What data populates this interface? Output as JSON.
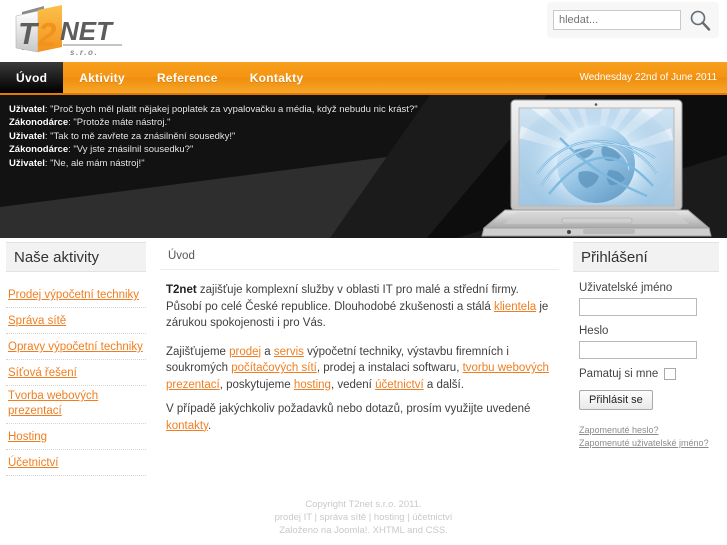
{
  "site": {
    "logo_main": "NET",
    "logo_t": "T",
    "logo_2": "2",
    "logo_sub": "s . r . o ."
  },
  "search": {
    "placeholder": "hledat...",
    "value": "",
    "icon": "search-icon"
  },
  "nav": {
    "items": [
      {
        "label": "Úvod",
        "active": true
      },
      {
        "label": "Aktivity",
        "active": false
      },
      {
        "label": "Reference",
        "active": false
      },
      {
        "label": "Kontakty",
        "active": false
      }
    ],
    "date": "Wednesday 22nd of June 2011"
  },
  "banner": {
    "lines": [
      {
        "speaker": "Uživatel",
        "text": ": \"Proč bych měl platit nějakej poplatek za vypalovačku a média, když nebudu nic krást?\""
      },
      {
        "speaker": "Zákonodárce",
        "text": ": \"Protože máte nástroj.\""
      },
      {
        "speaker": "Uživatel",
        "text": ": \"Tak to mě zavřete za znásilnění sousedky!\""
      },
      {
        "speaker": "Zákonodárce",
        "text": ": \"Vy jste znásilnil sousedku?\""
      },
      {
        "speaker": "Uživatel",
        "text": ": \"Ne, ale mám nástroj!\""
      }
    ],
    "image_name": "laptop-globe-network-graphic"
  },
  "sidebar": {
    "title": "Naše aktivity",
    "items": [
      {
        "label": "Prodej výpočetní techniky"
      },
      {
        "label": "Správa sítě"
      },
      {
        "label": "Opravy výpočetní techniky"
      },
      {
        "label": "Síťová řešení"
      },
      {
        "label": "Tvorba webových prezentací"
      },
      {
        "label": "Hosting"
      },
      {
        "label": "Účetnictví"
      }
    ]
  },
  "content": {
    "title": "Úvod",
    "p1": {
      "brand": "T2net",
      "t1": " zajišťuje komplexní služby v oblasti IT pro malé a střední firmy. Působí po celé České republice. Dlouhodobé zkušenosti a stálá ",
      "link1": "klientela",
      "t2": " je zárukou spokojenosti i pro Vás."
    },
    "p2": {
      "t1": "Zajišťujeme ",
      "link1": "prodej",
      "t2": " a ",
      "link2": "servis",
      "t3": " výpočetní techniky, výstavbu firemních i soukromých ",
      "link3": "počítačových sítí",
      "t4": ", prodej a instalaci softwaru, ",
      "link4": "tvorbu webových prezentací",
      "t5": ", poskytujeme ",
      "link5": "hosting",
      "t6": ", vedení ",
      "link6": "účetnictví",
      "t7": " a další."
    },
    "p3": {
      "t1": "V případě jakýchkoliv požadavků nebo dotazů, prosím využijte uvedené ",
      "link1": "kontakty",
      "t2": "."
    }
  },
  "login": {
    "title": "Přihlášení",
    "username_label": "Uživatelské jméno",
    "username_value": "",
    "password_label": "Heslo",
    "password_value": "",
    "remember_label": "Pamatuj si mne",
    "submit_label": "Přihlásit se",
    "forgot_password": "Zapomenuté heslo?",
    "forgot_username": "Zapomenuté uživatelské jméno?"
  },
  "footer": {
    "line1": "Copyright T2net s.r.o. 2011.",
    "line2": "prodej IT | správa sítě | hosting | účetnictví",
    "line3": "Založeno na Joomla!. XHTML and CSS."
  },
  "colors": {
    "accent_orange": "#f07e20",
    "nav_orange": "#f59412",
    "banner_dark": "#1b1b1b"
  }
}
